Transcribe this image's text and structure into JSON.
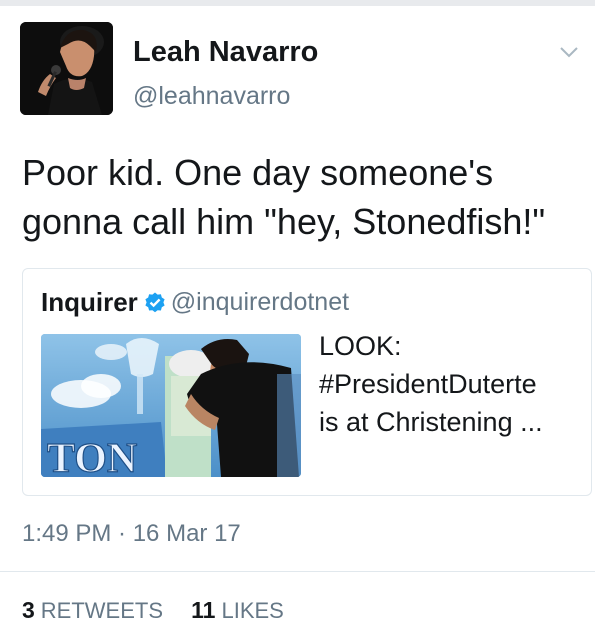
{
  "user": {
    "name": "Leah Navarro",
    "handle": "@leahnavarro"
  },
  "tweet": {
    "text": "Poor kid. One day someone's gonna call him \"hey, Stonedfish!\""
  },
  "quoted_tweet": {
    "name": "Inquirer",
    "verified": true,
    "handle": "@inquirerdotnet",
    "text_line1": "LOOK:",
    "text_line2": "#PresidentDuterte",
    "text_line3": "is at Christening ...",
    "image_sign_text": "TON"
  },
  "meta": {
    "timestamp": "1:49 PM · 16 Mar 17",
    "retweets_count": "3",
    "retweets_label": "RETWEETS",
    "likes_count": "11",
    "likes_label": "LIKES"
  },
  "colors": {
    "text": "#14171a",
    "muted": "#657786",
    "verified": "#1da1f2",
    "border": "#e1e8ed"
  },
  "icons": {
    "more": "chevron-down-icon",
    "verified": "verified-badge-icon"
  }
}
